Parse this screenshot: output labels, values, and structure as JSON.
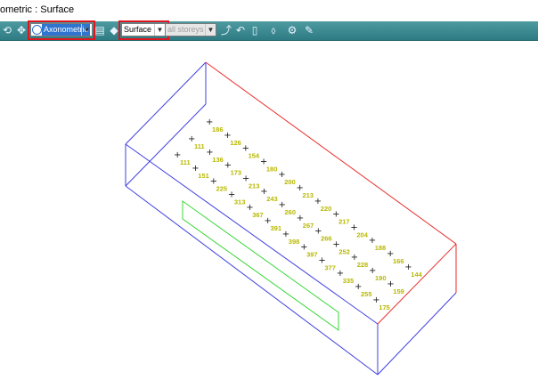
{
  "window": {
    "title": "ometric : Surface"
  },
  "toolbar": {
    "view_mode": "Axonometric",
    "display_mode": "Surface",
    "storey_filter": "all storeys",
    "highlight_color": "#e0141c"
  },
  "viewport": {
    "box_color": "#3f3fe0",
    "edge_highlight_color": "#e83030",
    "opening_color": "#38d838",
    "label_color": "#b8b800",
    "points": [
      {
        "label": "186"
      },
      {
        "label": "126"
      },
      {
        "label": "154"
      },
      {
        "label": "180"
      },
      {
        "label": "200"
      },
      {
        "label": "213"
      },
      {
        "label": "220"
      },
      {
        "label": "217"
      },
      {
        "label": "204"
      },
      {
        "label": "188"
      },
      {
        "label": "166"
      },
      {
        "label": "144"
      },
      {
        "label": "111"
      },
      {
        "label": "136"
      },
      {
        "label": "173"
      },
      {
        "label": "213"
      },
      {
        "label": "243"
      },
      {
        "label": "260"
      },
      {
        "label": "267"
      },
      {
        "label": "266"
      },
      {
        "label": "252"
      },
      {
        "label": "228"
      },
      {
        "label": "190"
      },
      {
        "label": "159"
      },
      {
        "label": "111"
      },
      {
        "label": "151"
      },
      {
        "label": "225"
      },
      {
        "label": "313"
      },
      {
        "label": "367"
      },
      {
        "label": "391"
      },
      {
        "label": "398"
      },
      {
        "label": "397"
      },
      {
        "label": "377"
      },
      {
        "label": "335"
      },
      {
        "label": "255"
      },
      {
        "label": "175"
      }
    ]
  }
}
